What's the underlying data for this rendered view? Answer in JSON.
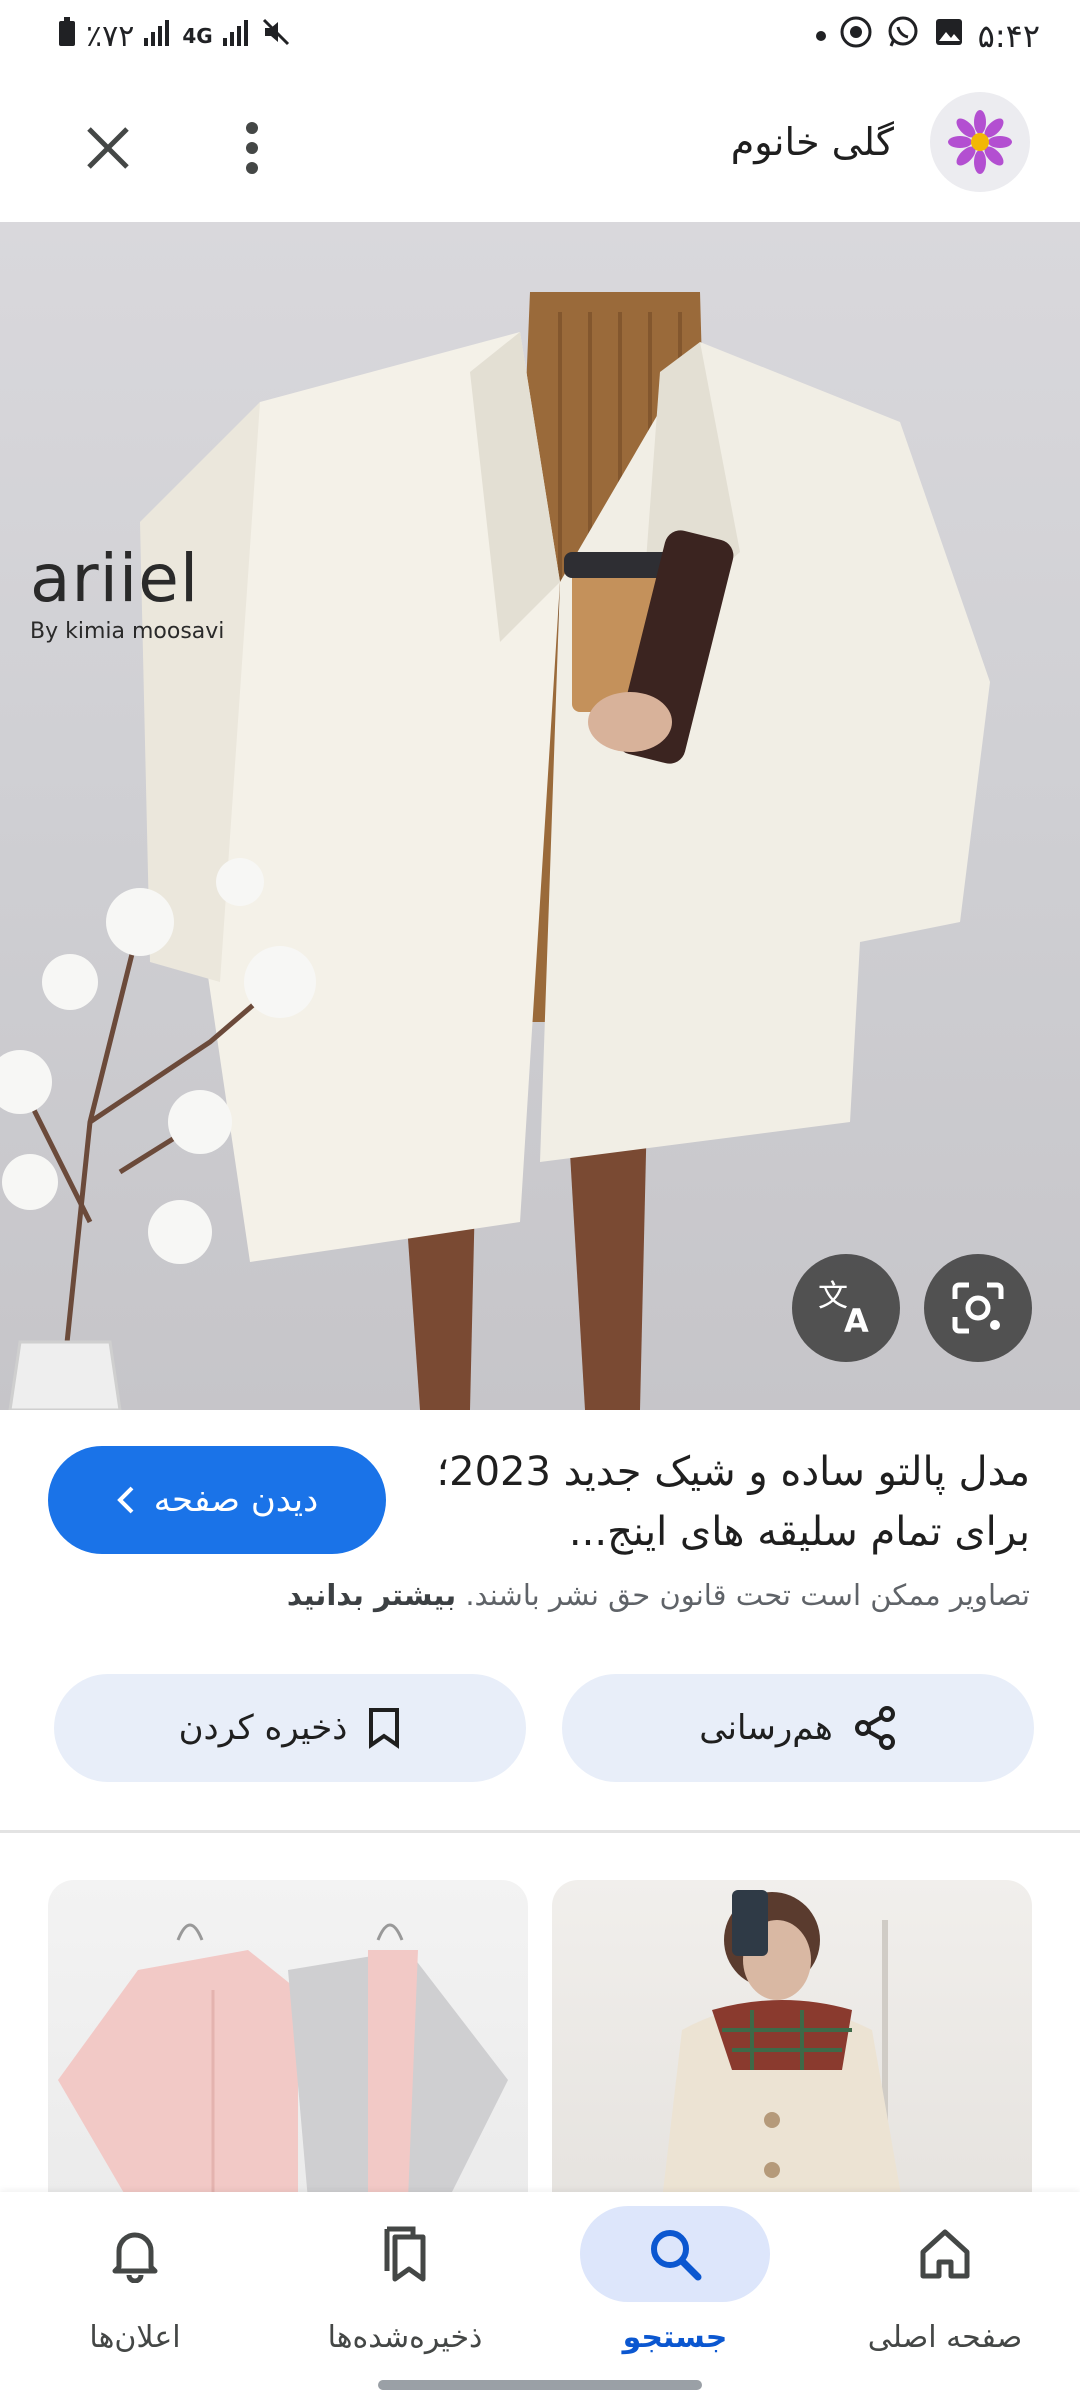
{
  "status_bar": {
    "time": "۵:۴۲",
    "battery": "٪۷۲",
    "network": "4G"
  },
  "header": {
    "source_name": "گلی خانوم",
    "icons": {
      "close": "close-icon",
      "more": "more-vert-icon",
      "avatar": "flower-icon"
    }
  },
  "image": {
    "brand_name": "ariiel",
    "brand_subtitle": "By kimia moosavi",
    "translate_icon": "translate-icon",
    "lens_icon": "lens-icon"
  },
  "result": {
    "title": "مدل پالتو ساده و شیک جدید 2023؛ برای تمام سلیقه های اینج...",
    "visit_label": "دیدن صفحه",
    "copyright_notice": "تصاویر ممکن است تحت قانون حق نشر باشند.",
    "learn_more": "بیشتر بدانید",
    "share_label": "هم‌رسانی",
    "save_label": "ذخیره کردن"
  },
  "bottom_nav": {
    "home": "صفحه اصلی",
    "search": "جستجو",
    "saved": "ذخیره‌شده‌ها",
    "notifications": "اعلان‌ها"
  },
  "colors": {
    "accent": "#1a73e8",
    "pill_bg": "#e8eef9",
    "nav_active": "#0b57d0"
  }
}
